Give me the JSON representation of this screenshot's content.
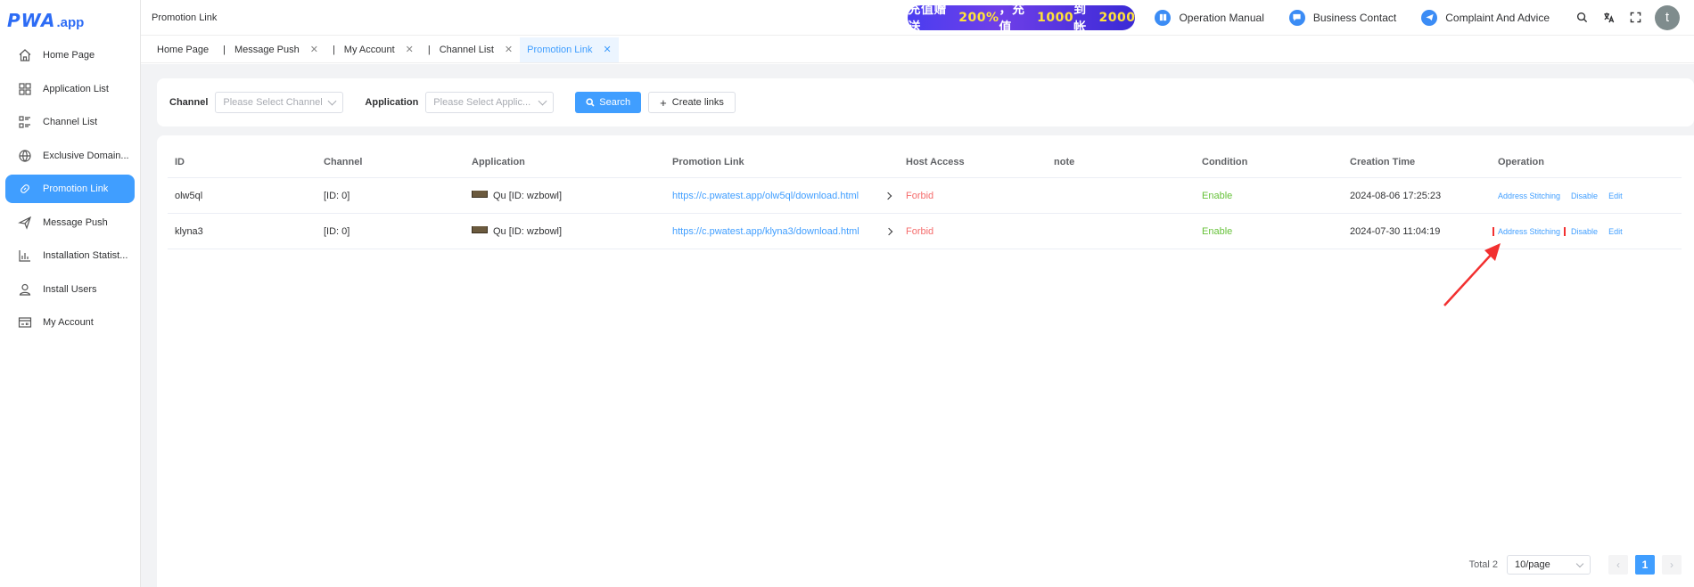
{
  "logo": {
    "mark": "PWA",
    "suffix": ".app"
  },
  "sidebar": {
    "items": [
      {
        "label": "Home Page",
        "icon": "home-icon"
      },
      {
        "label": "Application List",
        "icon": "grid-icon"
      },
      {
        "label": "Channel List",
        "icon": "list-icon"
      },
      {
        "label": "Exclusive Domain...",
        "icon": "globe-icon"
      },
      {
        "label": "Promotion Link",
        "icon": "link-icon"
      },
      {
        "label": "Message Push",
        "icon": "send-icon"
      },
      {
        "label": "Installation Statist...",
        "icon": "bar-chart-icon"
      },
      {
        "label": "Install Users",
        "icon": "user-icon"
      },
      {
        "label": "My Account",
        "icon": "id-card-icon"
      }
    ]
  },
  "header": {
    "breadcrumb": "Promotion Link",
    "promo_a": "充值赠送",
    "promo_b": "200%",
    "promo_c": "，充值",
    "promo_d": "1000",
    "promo_e": "到帐",
    "promo_f": "2000",
    "manual": "Operation Manual",
    "contact": "Business Contact",
    "complaint": "Complaint And Advice",
    "avatar": "t"
  },
  "tabs": [
    {
      "label": "Home Page"
    },
    {
      "label": "Message Push"
    },
    {
      "label": "My Account"
    },
    {
      "label": "Channel List"
    },
    {
      "label": "Promotion Link"
    }
  ],
  "filter": {
    "channel_label": "Channel",
    "channel_placeholder": "Please Select Channel",
    "application_label": "Application",
    "application_placeholder": "Please Select Applic...",
    "search": "Search",
    "create": "Create links"
  },
  "table": {
    "headers": [
      "ID",
      "Channel",
      "Application",
      "Promotion Link",
      "Host Access",
      "note",
      "Condition",
      "Creation Time",
      "Operation"
    ],
    "rows": [
      {
        "id": "olw5ql",
        "channel": "[ID: 0]",
        "application": "Qu [ID: wzbowl]",
        "link": "https://c.pwatest.app/olw5ql/download.html",
        "host_access": "Forbid",
        "note": "",
        "condition": "Enable",
        "created": "2024-08-06 17:25:23"
      },
      {
        "id": "klyna3",
        "channel": "[ID: 0]",
        "application": "Qu [ID: wzbowl]",
        "link": "https://c.pwatest.app/klyna3/download.html",
        "host_access": "Forbid",
        "note": "",
        "condition": "Enable",
        "created": "2024-07-30 11:04:19"
      }
    ],
    "ops": {
      "stitch": "Address Stitching",
      "disable": "Disable",
      "edit": "Edit"
    }
  },
  "pager": {
    "total": "Total 2",
    "size": "10/page",
    "prev": "‹",
    "page": "1",
    "next": "›"
  },
  "colors": {
    "accent": "#409eff",
    "danger": "#f56c6c",
    "success": "#67c23a",
    "highlight": "#f23030"
  }
}
